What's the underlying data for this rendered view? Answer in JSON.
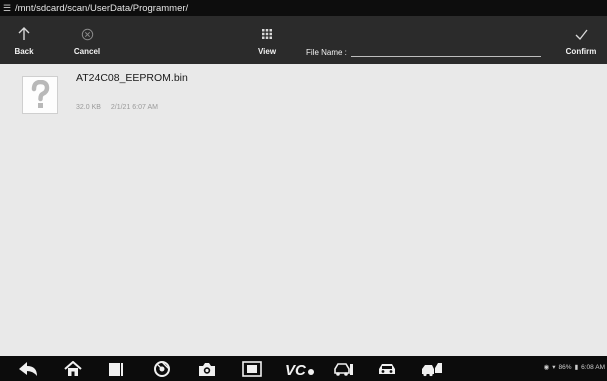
{
  "path": "/mnt/sdcard/scan/UserData/Programmer/",
  "toolbar": {
    "back_label": "Back",
    "back_icon": "arrow-up-icon",
    "cancel_label": "Cancel",
    "cancel_icon": "circle-x-icon",
    "view_label": "View",
    "view_icon": "grid-icon",
    "file_name_label": "File Name :",
    "file_name_value": "",
    "confirm_label": "Confirm",
    "confirm_icon": "checkmark-icon"
  },
  "files": [
    {
      "name": "AT24C08_EEPROM.bin",
      "size": "32.0 KB",
      "date": "2/1/21 6:07 AM",
      "icon": "unknown-file-icon"
    }
  ],
  "navbar": {
    "items": [
      "back-icon",
      "home-icon",
      "recent-apps-icon",
      "browser-icon",
      "camera-icon",
      "screen-capture-icon",
      "vci-icon",
      "car-service-icon",
      "car-icon",
      "car-diagnostics-icon"
    ],
    "status": {
      "battery": "86%",
      "time": "6:08 AM"
    }
  },
  "colors": {
    "topbar": "#0d0d0d",
    "toolbar": "#2b2b2b",
    "content": "#e9e9e9",
    "navbar": "#0c0c0c"
  }
}
